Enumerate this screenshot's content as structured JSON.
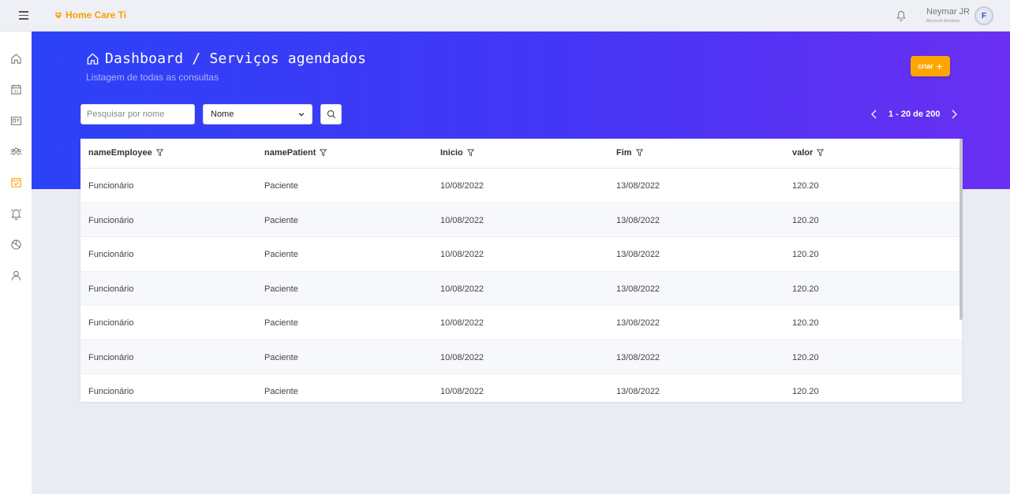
{
  "app": {
    "name": "Home Care Ti",
    "brand_color": "#ff9d00"
  },
  "user": {
    "name": "Neymar JR",
    "subtitle": "Microsoft Windows",
    "initial": "F"
  },
  "sidebar": {
    "items": [
      {
        "name": "home",
        "icon": "home-icon"
      },
      {
        "name": "calendar",
        "icon": "calendar-icon"
      },
      {
        "name": "id-card",
        "icon": "id-card-icon"
      },
      {
        "name": "team",
        "icon": "team-icon"
      },
      {
        "name": "schedule",
        "icon": "calendar-check-icon",
        "active": true
      },
      {
        "name": "alerts",
        "icon": "alarm-icon"
      },
      {
        "name": "reports",
        "icon": "pie-chart-icon"
      },
      {
        "name": "profile",
        "icon": "user-icon"
      }
    ],
    "active_color": "#ff9d00"
  },
  "header": {
    "title": "Dashboard / Serviços agendados",
    "subtitle": "Listagem de todas as consultas",
    "create_label": "criar"
  },
  "filters": {
    "search_placeholder": "Pesquisar por nome",
    "search_value": "",
    "select_value": "Nome"
  },
  "pagination": {
    "label": "1 - 20 de 200"
  },
  "table": {
    "columns": [
      "nameEmployee",
      "namePatient",
      "Inicio",
      "Fim",
      "valor"
    ],
    "rows": [
      [
        "Funcionário",
        "Paciente",
        "10/08/2022",
        "13/08/2022",
        "120.20"
      ],
      [
        "Funcionário",
        "Paciente",
        "10/08/2022",
        "13/08/2022",
        "120.20"
      ],
      [
        "Funcionário",
        "Paciente",
        "10/08/2022",
        "13/08/2022",
        "120.20"
      ],
      [
        "Funcionário",
        "Paciente",
        "10/08/2022",
        "13/08/2022",
        "120.20"
      ],
      [
        "Funcionário",
        "Paciente",
        "10/08/2022",
        "13/08/2022",
        "120.20"
      ],
      [
        "Funcionário",
        "Paciente",
        "10/08/2022",
        "13/08/2022",
        "120.20"
      ],
      [
        "Funcionário",
        "Paciente",
        "10/08/2022",
        "13/08/2022",
        "120.20"
      ]
    ]
  },
  "colors": {
    "hero_start": "#2c42f7",
    "hero_end": "#6a2ff2",
    "accent": "#ffa502"
  }
}
